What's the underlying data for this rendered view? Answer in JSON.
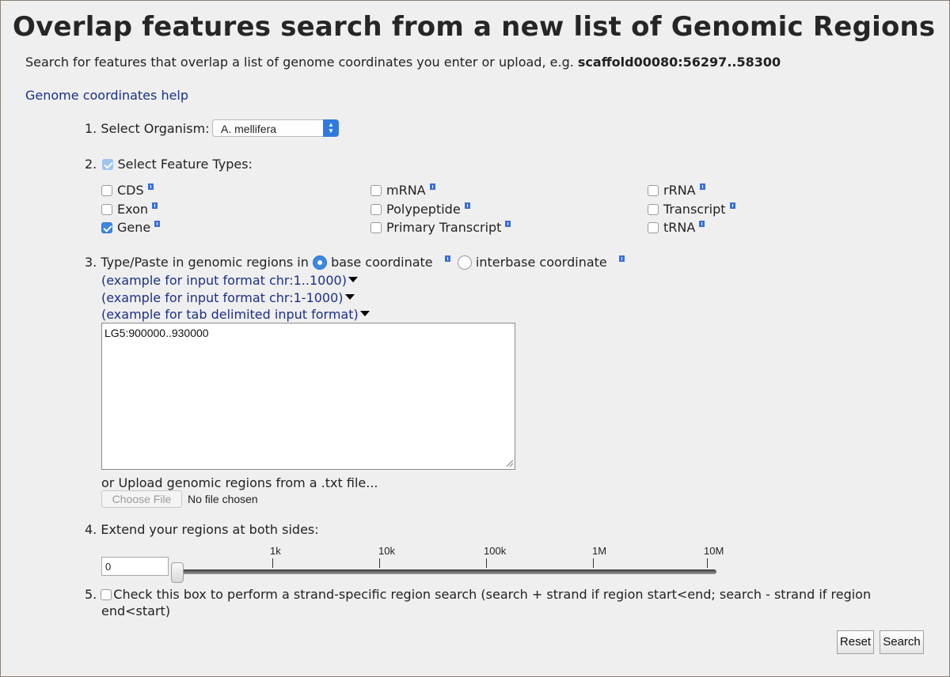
{
  "title": "Overlap features search from a new list of Genomic Regions",
  "intro": {
    "text": "Search for features that overlap a list of genome coordinates you enter or upload, e.g. ",
    "example": "scaffold00080:56297..58300"
  },
  "help_link": "Genome coordinates help",
  "step1": {
    "label": "1. Select Organism:",
    "selected": "A. mellifera"
  },
  "step2": {
    "label": "2.",
    "checkbox_label": "Select Feature Types:",
    "features": [
      {
        "label": "CDS",
        "checked": false
      },
      {
        "label": "Exon",
        "checked": false
      },
      {
        "label": "Gene",
        "checked": true
      },
      {
        "label": "mRNA",
        "checked": false
      },
      {
        "label": "Polypeptide",
        "checked": false
      },
      {
        "label": "Primary Transcript",
        "checked": false
      },
      {
        "label": "rRNA",
        "checked": false
      },
      {
        "label": "Transcript",
        "checked": false
      },
      {
        "label": "tRNA",
        "checked": false
      }
    ]
  },
  "step3": {
    "label": "3. Type/Paste in genomic regions in",
    "radio_base": "base coordinate",
    "radio_interbase": "interbase coordinate",
    "example1": "(example for input format chr:1..1000)",
    "example2": "(example for input format chr:1-1000)",
    "example3": "(example for tab delimited input format)",
    "textarea_value": "LG5:900000..930000",
    "upload_label": "or Upload genomic regions from a .txt file...",
    "choose_file": "Choose File",
    "no_file": "No file chosen"
  },
  "step4": {
    "label": "4. Extend your regions at both sides:",
    "value": "0",
    "ticks": [
      "1k",
      "10k",
      "100k",
      "1M",
      "10M"
    ]
  },
  "step5": {
    "label_num": "5.",
    "text_line1": "Check this box to perform a strand-specific region search (search + strand if region start<end; search - strand if region",
    "text_line2": "end<start)"
  },
  "buttons": {
    "reset": "Reset",
    "search": "Search"
  },
  "colors": {
    "accent": "#3a87e6",
    "link": "#1c2f8a",
    "background": "#efefef"
  }
}
